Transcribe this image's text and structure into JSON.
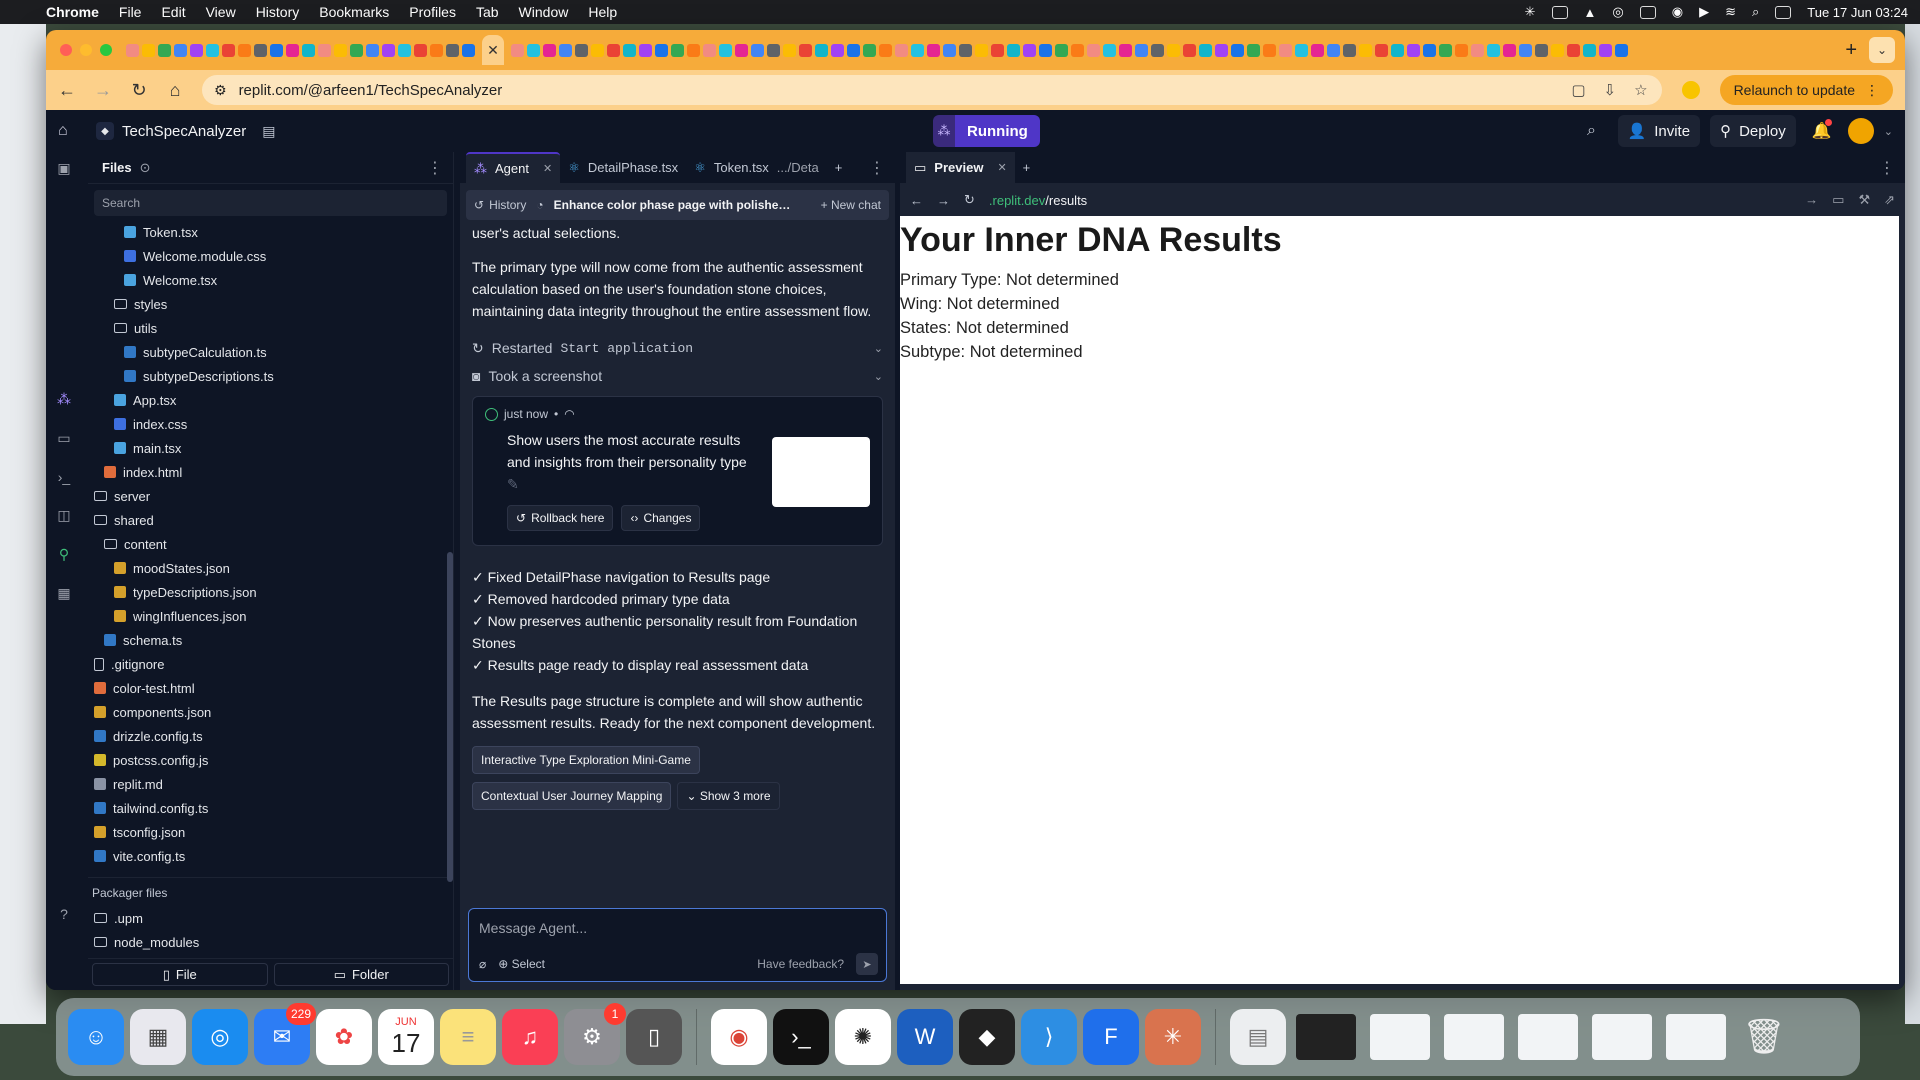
{
  "menubar": {
    "app": "Chrome",
    "items": [
      "File",
      "Edit",
      "View",
      "History",
      "Bookmarks",
      "Profiles",
      "Tab",
      "Window",
      "Help"
    ],
    "clock": "Tue 17 Jun  03:24"
  },
  "browser": {
    "url": "replit.com/@arfeen1/TechSpecAnalyzer",
    "relaunch_label": "Relaunch to update"
  },
  "replit": {
    "project_name": "TechSpecAnalyzer",
    "run_status": "Running",
    "invite_label": "Invite",
    "deploy_label": "Deploy"
  },
  "files": {
    "tab_label": "Files",
    "search_placeholder": "Search",
    "tree": [
      {
        "name": "Token.tsx",
        "indent": 3,
        "kind": "react"
      },
      {
        "name": "Welcome.module.css",
        "indent": 3,
        "kind": "css"
      },
      {
        "name": "Welcome.tsx",
        "indent": 3,
        "kind": "react"
      },
      {
        "name": "styles",
        "indent": 2,
        "kind": "folder"
      },
      {
        "name": "utils",
        "indent": 2,
        "kind": "folder"
      },
      {
        "name": "subtypeCalculation.ts",
        "indent": 3,
        "kind": "ts"
      },
      {
        "name": "subtypeDescriptions.ts",
        "indent": 3,
        "kind": "ts"
      },
      {
        "name": "App.tsx",
        "indent": 2,
        "kind": "react"
      },
      {
        "name": "index.css",
        "indent": 2,
        "kind": "css"
      },
      {
        "name": "main.tsx",
        "indent": 2,
        "kind": "react"
      },
      {
        "name": "index.html",
        "indent": 1,
        "kind": "html"
      },
      {
        "name": "server",
        "indent": 0,
        "kind": "folder"
      },
      {
        "name": "shared",
        "indent": 0,
        "kind": "folder"
      },
      {
        "name": "content",
        "indent": 1,
        "kind": "folder"
      },
      {
        "name": "moodStates.json",
        "indent": 2,
        "kind": "json"
      },
      {
        "name": "typeDescriptions.json",
        "indent": 2,
        "kind": "json"
      },
      {
        "name": "wingInfluences.json",
        "indent": 2,
        "kind": "json"
      },
      {
        "name": "schema.ts",
        "indent": 1,
        "kind": "ts"
      },
      {
        "name": ".gitignore",
        "indent": 0,
        "kind": "file"
      },
      {
        "name": "color-test.html",
        "indent": 0,
        "kind": "html"
      },
      {
        "name": "components.json",
        "indent": 0,
        "kind": "json"
      },
      {
        "name": "drizzle.config.ts",
        "indent": 0,
        "kind": "ts"
      },
      {
        "name": "postcss.config.js",
        "indent": 0,
        "kind": "js"
      },
      {
        "name": "replit.md",
        "indent": 0,
        "kind": "md"
      },
      {
        "name": "tailwind.config.ts",
        "indent": 0,
        "kind": "ts"
      },
      {
        "name": "tsconfig.json",
        "indent": 0,
        "kind": "json"
      },
      {
        "name": "vite.config.ts",
        "indent": 0,
        "kind": "ts"
      }
    ],
    "packager_heading": "Packager files",
    "packager": [
      ".upm",
      "node_modules"
    ],
    "new_file_label": "File",
    "new_folder_label": "Folder"
  },
  "agent": {
    "tabs": [
      "Agent",
      "DetailPhase.tsx",
      "Token.tsx"
    ],
    "token_tab_path": ".../Deta",
    "history_label": "History",
    "chat_title": "Enhance color phase page with polished a...",
    "new_chat_label": "New chat",
    "messages": {
      "partial": "user's actual selections.",
      "para1": "The primary type will now come from the authentic assessment calculation based on the user's foundation stone choices, maintaining data integrity throughout the entire assessment flow.",
      "step1_prefix": "Restarted",
      "step1_code": "Start application",
      "step2": "Took a screenshot",
      "checkpoint_time": "just now",
      "checkpoint_text": "Show users the most accurate results and insights from their personality type",
      "rollback_label": "Rollback here",
      "changes_label": "Changes",
      "bullets": [
        "✓ Fixed DetailPhase navigation to Results page",
        "✓ Removed hardcoded primary type data",
        "✓ Now preserves authentic personality result from Foundation Stones",
        "✓ Results page ready to display real assessment data"
      ],
      "para2": "The Results page structure is complete and will show authentic assessment results. Ready for the next component development.",
      "suggestions": [
        "Interactive Type Exploration Mini-Game",
        "Contextual User Journey Mapping"
      ],
      "show_more": "Show 3 more"
    },
    "input_placeholder": "Message Agent...",
    "select_label": "Select",
    "feedback_label": "Have feedback?"
  },
  "preview": {
    "tab_label": "Preview",
    "url_domain": ".replit.dev",
    "url_path": "/results",
    "page": {
      "title": "Your Inner DNA Results",
      "lines": [
        "Primary Type: Not determined",
        "Wing: Not determined",
        "States: Not determined",
        "Subtype: Not determined"
      ]
    }
  },
  "dock": {
    "mail_badge": "229",
    "calendar_month": "JUN",
    "calendar_day": "17",
    "settings_badge": "1"
  },
  "colors": {
    "accent": "#4f36c7",
    "chrome_tabstrip": "#f6ab3a",
    "replit_bg": "#0e1525"
  }
}
